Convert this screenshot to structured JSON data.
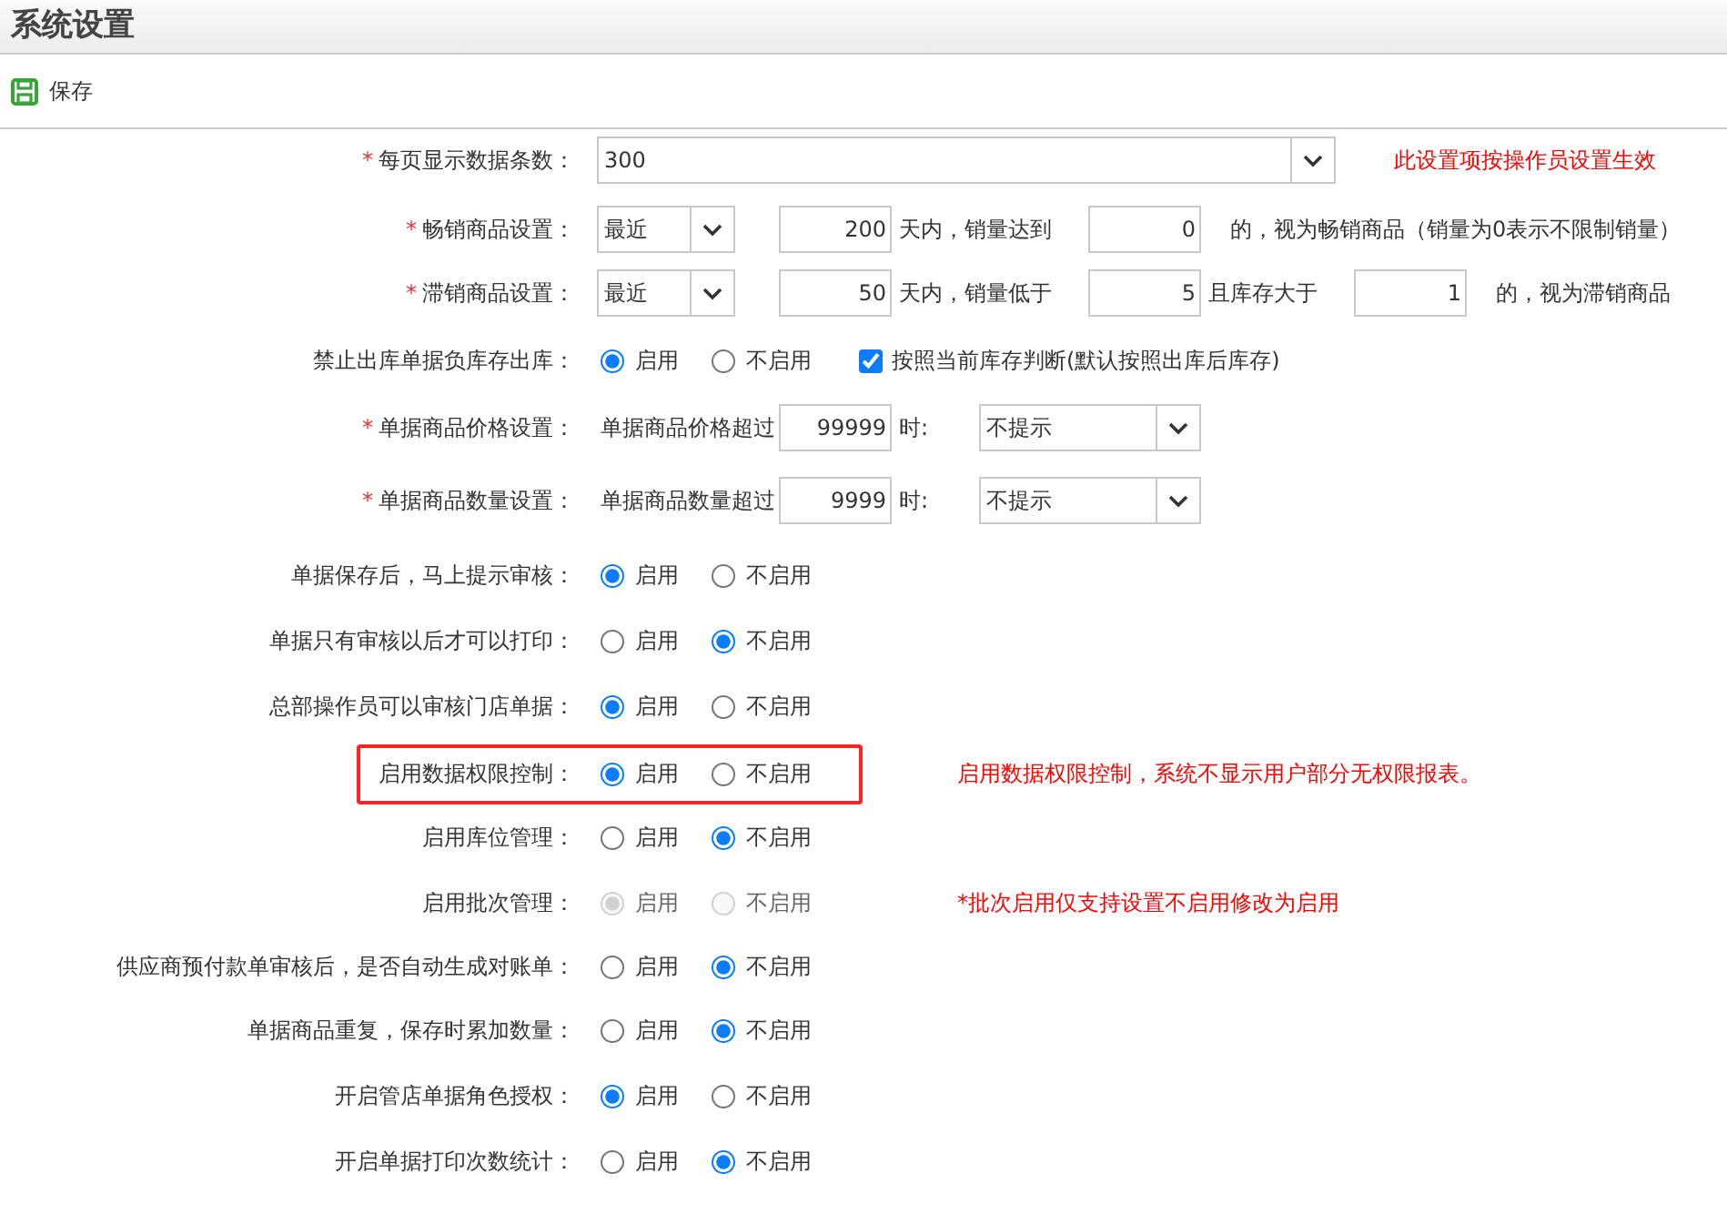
{
  "title": "系统设置",
  "toolbar": {
    "save_label": "保存"
  },
  "settings": [
    {
      "label": "每页显示数据条数：",
      "marker": "*",
      "highlighted": false,
      "controls": [
        {
          "kind": "combo",
          "value": "300"
        },
        {
          "kind": "note",
          "text": "此设置项按操作员设置生效"
        }
      ]
    },
    {
      "label": "畅销商品设置：",
      "marker": "*",
      "highlighted": false,
      "controls": [
        {
          "kind": "select",
          "value": "最近"
        },
        {
          "kind": "number",
          "value": "200"
        },
        {
          "kind": "text",
          "text": "天内，销量达到"
        },
        {
          "kind": "number",
          "value": "0"
        },
        {
          "kind": "text",
          "text": "的，视为畅销商品（销量为0表示不限制销量）"
        }
      ]
    },
    {
      "label": "滞销商品设置：",
      "marker": "*",
      "highlighted": false,
      "controls": [
        {
          "kind": "select",
          "value": "最近"
        },
        {
          "kind": "number",
          "value": "50"
        },
        {
          "kind": "text",
          "text": "天内，销量低于"
        },
        {
          "kind": "number",
          "value": "5"
        },
        {
          "kind": "text",
          "text": "且库存大于"
        },
        {
          "kind": "number",
          "value": "1"
        },
        {
          "kind": "text",
          "text": "的，视为滞销商品"
        }
      ]
    },
    {
      "label": "禁止出库单据负库存出库：",
      "highlighted": false,
      "controls": [
        {
          "kind": "radio",
          "label": "启用",
          "selected": true,
          "disabled": false
        },
        {
          "kind": "radio",
          "label": "不启用",
          "selected": false,
          "disabled": false
        },
        {
          "kind": "checkbox",
          "label": "按照当前库存判断(默认按照出库后库存)",
          "checked": true
        }
      ]
    },
    {
      "label": "单据商品价格设置：",
      "marker": "*",
      "highlighted": false,
      "controls": [
        {
          "kind": "text",
          "text": "单据商品价格超过"
        },
        {
          "kind": "number",
          "value": "99999"
        },
        {
          "kind": "text",
          "text": "时:"
        },
        {
          "kind": "wideselect",
          "value": "不提示"
        }
      ]
    },
    {
      "label": "单据商品数量设置：",
      "marker": "*",
      "highlighted": false,
      "controls": [
        {
          "kind": "text",
          "text": "单据商品数量超过"
        },
        {
          "kind": "number",
          "value": "9999"
        },
        {
          "kind": "text",
          "text": "时:"
        },
        {
          "kind": "wideselect",
          "value": "不提示"
        }
      ]
    },
    {
      "label": "单据保存后，马上提示审核：",
      "highlighted": false,
      "controls": [
        {
          "kind": "radio",
          "label": "启用",
          "selected": true,
          "disabled": false
        },
        {
          "kind": "radio",
          "label": "不启用",
          "selected": false,
          "disabled": false
        }
      ]
    },
    {
      "label": "单据只有审核以后才可以打印：",
      "highlighted": false,
      "controls": [
        {
          "kind": "radio",
          "label": "启用",
          "selected": false,
          "disabled": false
        },
        {
          "kind": "radio",
          "label": "不启用",
          "selected": true,
          "disabled": false
        }
      ]
    },
    {
      "label": "总部操作员可以审核门店单据：",
      "highlighted": false,
      "controls": [
        {
          "kind": "radio",
          "label": "启用",
          "selected": true,
          "disabled": false
        },
        {
          "kind": "radio",
          "label": "不启用",
          "selected": false,
          "disabled": false
        }
      ]
    },
    {
      "label": "启用数据权限控制：",
      "highlighted": true,
      "controls": [
        {
          "kind": "radio",
          "label": "启用",
          "selected": true,
          "disabled": false
        },
        {
          "kind": "radio",
          "label": "不启用",
          "selected": false,
          "disabled": false
        },
        {
          "kind": "note",
          "text": "启用数据权限控制，系统不显示用户部分无权限报表。"
        }
      ]
    },
    {
      "label": "启用库位管理：",
      "highlighted": false,
      "controls": [
        {
          "kind": "radio",
          "label": "启用",
          "selected": false,
          "disabled": false
        },
        {
          "kind": "radio",
          "label": "不启用",
          "selected": true,
          "disabled": false
        }
      ]
    },
    {
      "label": "启用批次管理：",
      "highlighted": false,
      "controls": [
        {
          "kind": "radio",
          "label": "启用",
          "selected": true,
          "disabled": true
        },
        {
          "kind": "radio",
          "label": "不启用",
          "selected": false,
          "disabled": true
        },
        {
          "kind": "note",
          "text": "*批次启用仅支持设置不启用修改为启用"
        }
      ]
    },
    {
      "label": "供应商预付款单审核后，是否自动生成对账单：",
      "highlighted": false,
      "controls": [
        {
          "kind": "radio",
          "label": "启用",
          "selected": false,
          "disabled": false
        },
        {
          "kind": "radio",
          "label": "不启用",
          "selected": true,
          "disabled": false
        }
      ]
    },
    {
      "label": "单据商品重复，保存时累加数量：",
      "highlighted": false,
      "controls": [
        {
          "kind": "radio",
          "label": "启用",
          "selected": false,
          "disabled": false
        },
        {
          "kind": "radio",
          "label": "不启用",
          "selected": true,
          "disabled": false
        }
      ]
    },
    {
      "label": "开启管店单据角色授权：",
      "highlighted": false,
      "controls": [
        {
          "kind": "radio",
          "label": "启用",
          "selected": true,
          "disabled": false
        },
        {
          "kind": "radio",
          "label": "不启用",
          "selected": false,
          "disabled": false
        }
      ]
    },
    {
      "label": "开启单据打印次数统计：",
      "highlighted": false,
      "controls": [
        {
          "kind": "radio",
          "label": "启用",
          "selected": false,
          "disabled": false
        },
        {
          "kind": "radio",
          "label": "不启用",
          "selected": true,
          "disabled": false
        }
      ]
    }
  ]
}
